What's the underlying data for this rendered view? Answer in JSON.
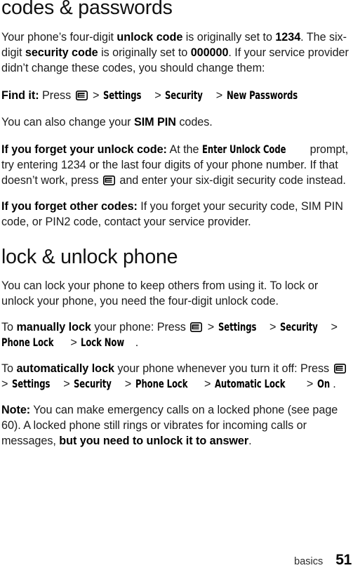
{
  "page": {
    "chapter": "basics",
    "number": "51"
  },
  "sections": [
    {
      "id": "codes",
      "heading": "codes & passwords",
      "paragraphs": [
        {
          "id": "intro",
          "runs": [
            {
              "t": "Your phone’s four-digit ",
              "s": "normal"
            },
            {
              "t": "unlock code",
              "s": "bold"
            },
            {
              "t": " is originally set to ",
              "s": "normal"
            },
            {
              "t": "1234",
              "s": "bold"
            },
            {
              "t": ". The six-digit ",
              "s": "normal"
            },
            {
              "t": "security code",
              "s": "bold"
            },
            {
              "t": " is originally set to ",
              "s": "normal"
            },
            {
              "t": "000000",
              "s": "bold"
            },
            {
              "t": ". If your service provider didn’t change these codes, you should change them:",
              "s": "normal"
            }
          ]
        },
        {
          "id": "find-it",
          "label": "Find it:",
          "press": "Press",
          "icon": "menu-key-icon",
          "trail": [
            "Settings",
            "Security",
            "New Passwords"
          ],
          "separator": ">",
          "tail": ""
        },
        {
          "id": "sim-pin",
          "runs": [
            {
              "t": "You can also change your ",
              "s": "normal"
            },
            {
              "t": "SIM PIN",
              "s": "bold"
            },
            {
              "t": " codes.",
              "s": "normal"
            }
          ]
        },
        {
          "id": "forget-unlock",
          "runs": [
            {
              "t": "If you forget your unlock code:",
              "s": "bold"
            },
            {
              "t": " At the ",
              "s": "normal"
            },
            {
              "t": "Enter Unlock Code",
              "s": "path"
            },
            {
              "t": " prompt, try entering 1234 or the last four digits of your phone number. If that doesn’t work, press ",
              "s": "normal"
            },
            {
              "t": "",
              "s": "icon"
            },
            {
              "t": " and enter your six-digit security code instead.",
              "s": "normal"
            }
          ]
        },
        {
          "id": "forget-other",
          "runs": [
            {
              "t": "If you forget other codes:",
              "s": "bold"
            },
            {
              "t": " If you forget your security code, SIM PIN code, or PIN2 code, contact your service provider.",
              "s": "normal"
            }
          ]
        }
      ]
    },
    {
      "id": "lock",
      "heading": "lock & unlock phone",
      "paragraphs": [
        {
          "id": "lock-intro",
          "runs": [
            {
              "t": "You can lock your phone to keep others from using it. To lock or unlock your phone, you need the four-digit unlock code.",
              "s": "normal"
            }
          ]
        },
        {
          "id": "manual-lock",
          "runs": [
            {
              "t": "To ",
              "s": "normal"
            },
            {
              "t": "manually lock",
              "s": "bold"
            },
            {
              "t": " your phone: Press ",
              "s": "normal"
            },
            {
              "t": "",
              "s": "icon"
            },
            {
              "t": " > ",
              "s": "gt"
            },
            {
              "t": "Settings",
              "s": "path"
            },
            {
              "t": " > ",
              "s": "gt"
            },
            {
              "t": "Security",
              "s": "path"
            },
            {
              "t": " > ",
              "s": "gt"
            },
            {
              "t": "Phone Lock",
              "s": "path"
            },
            {
              "t": " > ",
              "s": "gt"
            },
            {
              "t": "Lock Now",
              "s": "path"
            },
            {
              "t": ".",
              "s": "normal"
            }
          ]
        },
        {
          "id": "auto-lock",
          "runs": [
            {
              "t": "To ",
              "s": "normal"
            },
            {
              "t": "automatically lock",
              "s": "bold"
            },
            {
              "t": " your phone whenever you turn it off: Press ",
              "s": "normal"
            },
            {
              "t": "",
              "s": "icon"
            },
            {
              "t": " > ",
              "s": "gt"
            },
            {
              "t": "Settings",
              "s": "path"
            },
            {
              "t": " > ",
              "s": "gt"
            },
            {
              "t": "Security",
              "s": "path"
            },
            {
              "t": " > ",
              "s": "gt"
            },
            {
              "t": "Phone Lock",
              "s": "path"
            },
            {
              "t": " > ",
              "s": "gt"
            },
            {
              "t": "Automatic Lock",
              "s": "path"
            },
            {
              "t": " > ",
              "s": "gt"
            },
            {
              "t": "On",
              "s": "path"
            },
            {
              "t": ".",
              "s": "normal"
            }
          ]
        },
        {
          "id": "note",
          "runs": [
            {
              "t": "Note:",
              "s": "bold"
            },
            {
              "t": " You can make emergency calls on a locked phone (see page 60). A locked phone still rings or vibrates for incoming calls or messages, ",
              "s": "normal"
            },
            {
              "t": "but you need to unlock it to answer",
              "s": "bold"
            },
            {
              "t": ".",
              "s": "normal"
            }
          ]
        }
      ]
    }
  ],
  "icons": {
    "menu_key": "menu-key-icon"
  },
  "colors": {
    "text": "#1c1c1c",
    "bold": "#000000",
    "background": "#ffffff"
  }
}
